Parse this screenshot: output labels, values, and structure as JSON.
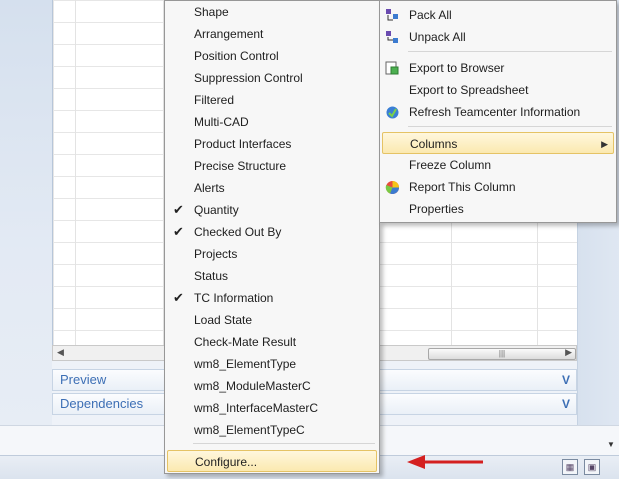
{
  "left_menu": {
    "items": [
      {
        "label": "Shape",
        "checked": false
      },
      {
        "label": "Arrangement",
        "checked": false
      },
      {
        "label": "Position Control",
        "checked": false
      },
      {
        "label": "Suppression Control",
        "checked": false
      },
      {
        "label": "Filtered",
        "checked": false
      },
      {
        "label": "Multi-CAD",
        "checked": false
      },
      {
        "label": "Product Interfaces",
        "checked": false
      },
      {
        "label": "Precise Structure",
        "checked": false
      },
      {
        "label": "Alerts",
        "checked": false
      },
      {
        "label": "Quantity",
        "checked": true
      },
      {
        "label": "Checked Out By",
        "checked": true
      },
      {
        "label": "Projects",
        "checked": false
      },
      {
        "label": "Status",
        "checked": false
      },
      {
        "label": "TC Information",
        "checked": true
      },
      {
        "label": "Load State",
        "checked": false
      },
      {
        "label": "Check-Mate Result",
        "checked": false
      },
      {
        "label": "wm8_ElementType",
        "checked": false
      },
      {
        "label": "wm8_ModuleMasterC",
        "checked": false
      },
      {
        "label": "wm8_InterfaceMasterC",
        "checked": false
      },
      {
        "label": "wm8_ElementTypeC",
        "checked": false
      }
    ],
    "configure_label": "Configure...",
    "check_glyph": "✔"
  },
  "right_menu": {
    "pack_all": "Pack All",
    "unpack_all": "Unpack All",
    "export_browser": "Export to Browser",
    "export_spreadsheet": "Export to Spreadsheet",
    "refresh_tc": "Refresh Teamcenter Information",
    "columns": "Columns",
    "freeze_column": "Freeze Column",
    "report_column": "Report This Column",
    "properties": "Properties",
    "submenu_glyph": "▶"
  },
  "panels": {
    "preview": "Preview",
    "dependencies": "Dependencies",
    "chevron_glyph": "V"
  },
  "scrollbar": {
    "left_arrow": "◀",
    "right_arrow": "▶",
    "grip": "|||"
  },
  "colors": {
    "menu_highlight": "#fbe9b0",
    "panel_header_text": "#3d6fb5",
    "annotation_arrow": "#d42020"
  }
}
